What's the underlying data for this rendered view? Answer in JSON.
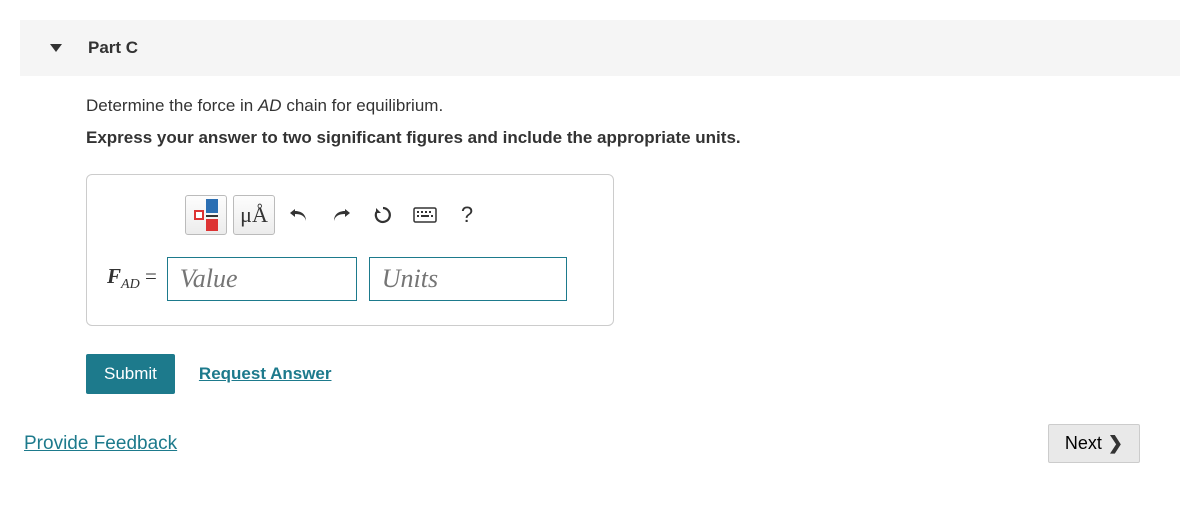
{
  "header": {
    "part_label": "Part C"
  },
  "question": {
    "prefix": "Determine the force in ",
    "var": "AD",
    "suffix": " chain for equilibrium.",
    "instruction": "Express your answer to two significant figures and include the appropriate units."
  },
  "toolbar": {
    "special_chars": "μÅ",
    "help": "?"
  },
  "answer": {
    "var_main": "F",
    "var_sub": "AD",
    "equals": " = ",
    "value_placeholder": "Value",
    "units_placeholder": "Units"
  },
  "actions": {
    "submit": "Submit",
    "request_answer": "Request Answer"
  },
  "footer": {
    "feedback": "Provide Feedback",
    "next": "Next"
  }
}
